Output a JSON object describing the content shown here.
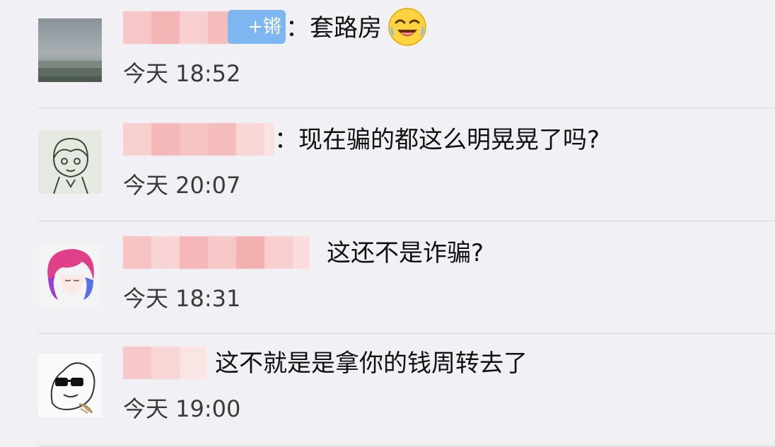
{
  "comments": [
    {
      "badge": "+锵",
      "separator": "：",
      "text": "套路房",
      "emoji": "crying-laughing-emoji",
      "time": "今天 18:52"
    },
    {
      "separator": "：",
      "text": "现在骗的都这么明晃晃了吗?",
      "time": "今天 20:07"
    },
    {
      "text": "这还不是诈骗?",
      "time": "今天 18:31"
    },
    {
      "text": "这不就是是拿你的钱周转去了",
      "time": "今天 19:00"
    }
  ],
  "colors": {
    "background": "#f1f1f5",
    "divider": "#d6d6db",
    "blur_pink": "#f4b8b8",
    "badge_blue": "#7db6f0"
  }
}
